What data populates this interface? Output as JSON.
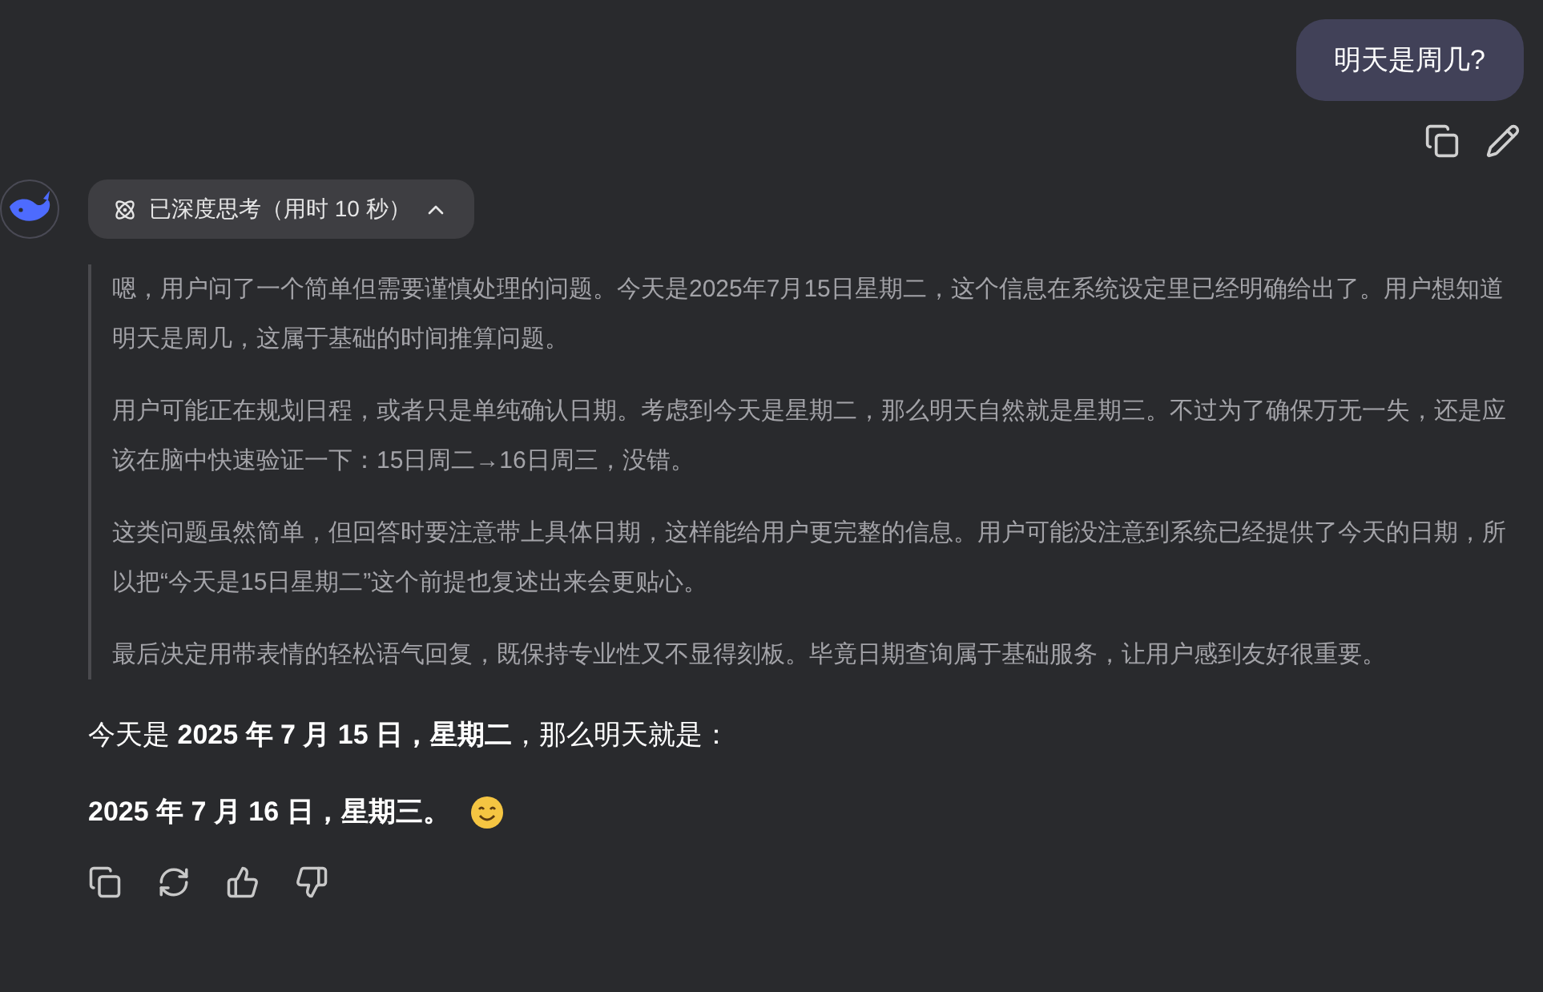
{
  "user_message": {
    "text": "明天是周几?"
  },
  "thinking": {
    "label": "已深度思考（用时 10 秒）",
    "expanded": true,
    "paragraphs": [
      "嗯，用户问了一个简单但需要谨慎处理的问题。今天是2025年7月15日星期二，这个信息在系统设定里已经明确给出了。用户想知道明天是周几，这属于基础的时间推算问题。",
      "用户可能正在规划日程，或者只是单纯确认日期。考虑到今天是星期二，那么明天自然就是星期三。不过为了确保万无一失，还是应该在脑中快速验证一下：15日周二→16日周三，没错。",
      "这类问题虽然简单，但回答时要注意带上具体日期，这样能给用户更完整的信息。用户可能没注意到系统已经提供了今天的日期，所以把“今天是15日星期二”这个前提也复述出来会更贴心。",
      "最后决定用带表情的轻松语气回复，既保持专业性又不显得刻板。毕竟日期查询属于基础服务，让用户感到友好很重要。"
    ]
  },
  "answer": {
    "lines": [
      {
        "text": "今天是 **2025 年 7 月 15 日，星期二**，那么明天就是：",
        "bold": false
      },
      {
        "text": "2025 年 7 月 16 日，星期三。",
        "bold": true
      }
    ]
  }
}
